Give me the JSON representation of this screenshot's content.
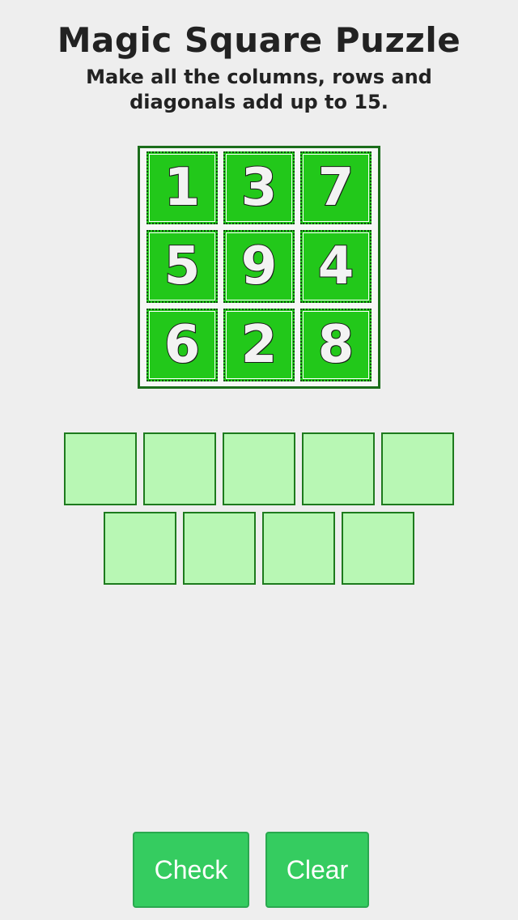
{
  "header": {
    "title": "Magic Square Puzzle",
    "subtitle": "Make all the columns, rows and diagonals add up to 15."
  },
  "board": {
    "rows": [
      [
        "1",
        "3",
        "7"
      ],
      [
        "5",
        "9",
        "4"
      ],
      [
        "6",
        "2",
        "8"
      ]
    ]
  },
  "answer_slots": {
    "row1": [
      "",
      "",
      "",
      "",
      ""
    ],
    "row2": [
      "",
      "",
      "",
      ""
    ]
  },
  "buttons": {
    "check_label": "Check",
    "clear_label": "Clear"
  },
  "colors": {
    "background": "#eeeeee",
    "tile_fill": "#22c81a",
    "board_border": "#1b6d1b",
    "slot_fill": "#b8f7b4",
    "button_fill": "#35cc60"
  }
}
